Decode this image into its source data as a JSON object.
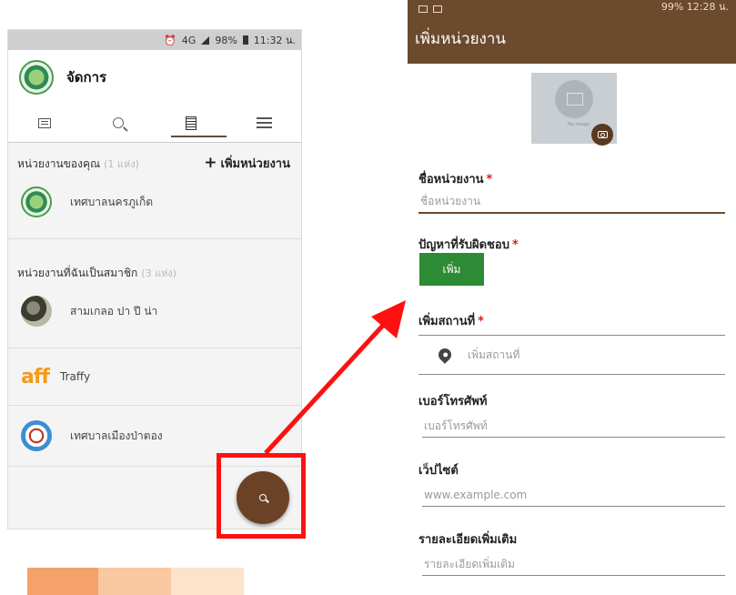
{
  "left": {
    "status": {
      "alarm": "⏰",
      "network": "4G",
      "battery": "98%",
      "time": "11:32 น."
    },
    "header": {
      "title": "จัดการ"
    },
    "tabs": [
      {
        "icon": "list-icon"
      },
      {
        "icon": "search-icon"
      },
      {
        "icon": "building-icon",
        "active": true
      },
      {
        "icon": "menu-icon"
      }
    ],
    "my_orgs": {
      "title": "หน่วยงานของคุณ",
      "count": "(1 แห่ง)",
      "add_label": "เพิ่มหน่วยงาน",
      "items": [
        {
          "name": "เทศบาลนครภูเก็ต"
        }
      ]
    },
    "member_orgs": {
      "title": "หน่วยงานที่ฉันเป็นสมาชิก",
      "count": "(3 แห่ง)",
      "items": [
        {
          "name": "สามเกลอ ปา ปี น่า"
        },
        {
          "name": "Traffy",
          "logo_text": "aff"
        },
        {
          "name": "เทศบาลเมืองป่าตอง"
        }
      ]
    },
    "fab_icon": "search-icon"
  },
  "right": {
    "status": {
      "time": "12:28 น.",
      "battery": "99%"
    },
    "appbar_title": "เพิ่มหน่วยงาน",
    "image_caption": "No image",
    "fields": {
      "name": {
        "label": "ชื่อหน่วยงาน",
        "placeholder": "ชื่อหน่วยงาน",
        "required": "*"
      },
      "problems": {
        "label": "ปัญหาที่รับผิดชอบ",
        "required": "*",
        "button": "เพิ่ม"
      },
      "location": {
        "label": "เพิ่มสถานที่",
        "required": "*",
        "placeholder": "เพิ่มสถานที่"
      },
      "phone": {
        "label": "เบอร์โทรศัพท์",
        "placeholder": "เบอร์โทรศัพท์"
      },
      "website": {
        "label": "เว็ปไซต์",
        "placeholder": "www.example.com"
      },
      "details": {
        "label": "รายละเอียดเพิ่มเติม",
        "placeholder": "รายละเอียดเพิ่มเติม"
      }
    }
  },
  "colors": {
    "brand_brown": "#6b4a2e",
    "fab_brown": "#6b4226",
    "add_green": "#2e8b35",
    "highlight_red": "#ff1010",
    "swatches": [
      "#f4a16a",
      "#f9c7a0",
      "#fde2cc"
    ]
  }
}
